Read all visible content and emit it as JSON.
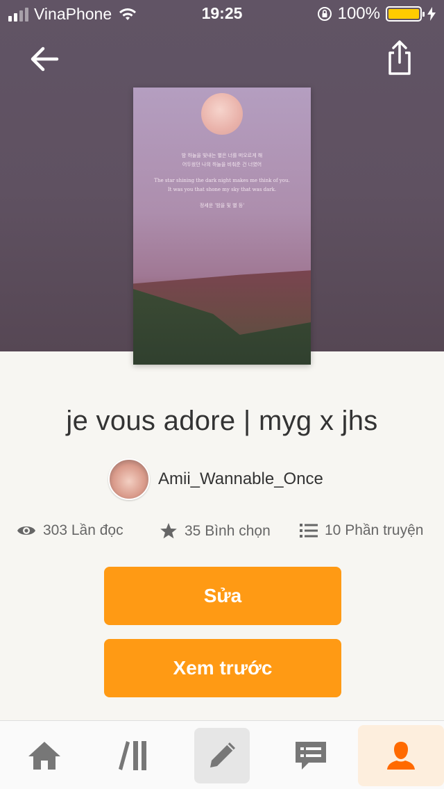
{
  "status_bar": {
    "carrier": "VinaPhone",
    "time": "19:25",
    "battery": "100%",
    "battery_color": "#ffcc00"
  },
  "header": {
    "back_icon": "arrow-left-icon",
    "share_icon": "share-icon"
  },
  "cover": {
    "text_lines": [
      "밤 하늘을 빛내는 별은 너를 떠오르게 해",
      "어두웠던 나의 하늘을 비춰준 건 너였어",
      "The star shining the dark night makes me think of you.",
      "It was you that shone my sky that was dark.",
      "정세운 '밤을 및 별 등'"
    ]
  },
  "story": {
    "title": "je vous adore | myg x jhs",
    "author": "Amii_Wannable_Once"
  },
  "stats": {
    "reads": "303 Lần đọc",
    "votes": "35 Bình chọn",
    "parts": "10 Phần truyện"
  },
  "actions": {
    "edit_label": "Sửa",
    "preview_label": "Xem trước",
    "accent_color": "#ff9a14"
  },
  "tabbar": {
    "items": [
      "home-icon",
      "library-icon",
      "write-icon",
      "messages-icon",
      "profile-icon"
    ],
    "active": "profile-icon"
  }
}
